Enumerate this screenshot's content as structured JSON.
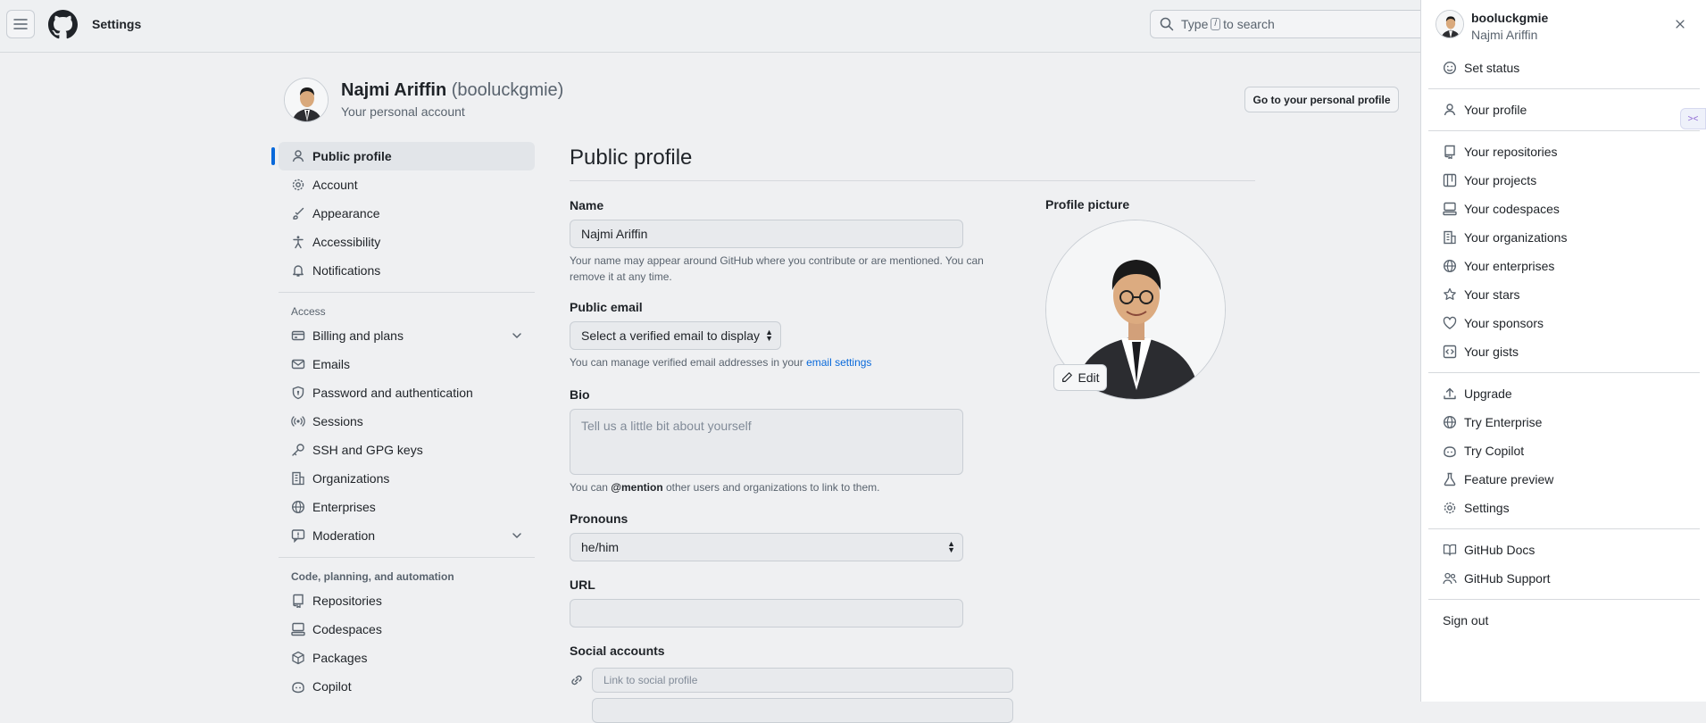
{
  "header": {
    "title": "Settings",
    "search": {
      "prefix": "Type",
      "key": "/",
      "suffix": "to search"
    }
  },
  "account": {
    "name": "Najmi Ariffin",
    "handle": "(booluckgmie)",
    "subtitle": "Your personal account",
    "goto_button": "Go to your personal profile"
  },
  "nav": {
    "items_top": [
      {
        "label": "Public profile",
        "icon": "person-icon",
        "active": true
      },
      {
        "label": "Account",
        "icon": "gear-icon"
      },
      {
        "label": "Appearance",
        "icon": "paintbrush-icon"
      },
      {
        "label": "Accessibility",
        "icon": "accessibility-icon"
      },
      {
        "label": "Notifications",
        "icon": "bell-icon"
      }
    ],
    "access_heading": "Access",
    "items_access": [
      {
        "label": "Billing and plans",
        "icon": "credit-card-icon",
        "expandable": true
      },
      {
        "label": "Emails",
        "icon": "mail-icon"
      },
      {
        "label": "Password and authentication",
        "icon": "shield-lock-icon"
      },
      {
        "label": "Sessions",
        "icon": "broadcast-icon"
      },
      {
        "label": "SSH and GPG keys",
        "icon": "key-icon"
      },
      {
        "label": "Organizations",
        "icon": "organization-icon"
      },
      {
        "label": "Enterprises",
        "icon": "globe-icon"
      },
      {
        "label": "Moderation",
        "icon": "report-icon",
        "expandable": true
      }
    ],
    "code_heading": "Code, planning, and automation",
    "items_code": [
      {
        "label": "Repositories",
        "icon": "repo-icon"
      },
      {
        "label": "Codespaces",
        "icon": "codespaces-icon"
      },
      {
        "label": "Packages",
        "icon": "package-icon"
      },
      {
        "label": "Copilot",
        "icon": "copilot-icon"
      }
    ]
  },
  "main": {
    "title": "Public profile",
    "name_label": "Name",
    "name_value": "Najmi Ariffin",
    "name_note": "Your name may appear around GitHub where you contribute or are mentioned. You can remove it at any time.",
    "email_label": "Public email",
    "email_value": "Select a verified email to display",
    "email_note_prefix": "You can manage verified email addresses in your",
    "email_note_link": "email settings",
    "bio_label": "Bio",
    "bio_placeholder": "Tell us a little bit about yourself",
    "bio_note_prefix": "You can",
    "bio_note_mention": "@mention",
    "bio_note_suffix": "other users and organizations to link to them.",
    "pronouns_label": "Pronouns",
    "pronouns_value": "he/him",
    "url_label": "URL",
    "url_value": "",
    "social_label": "Social accounts",
    "social_placeholder": "Link to social profile",
    "picture_label": "Profile picture",
    "edit_label": "Edit"
  },
  "panel": {
    "username": "booluckgmie",
    "fullname": "Najmi Ariffin",
    "groups": [
      [
        {
          "label": "Set status",
          "icon": "smiley-icon"
        }
      ],
      [
        {
          "label": "Your profile",
          "icon": "person-icon"
        }
      ],
      [
        {
          "label": "Your repositories",
          "icon": "repo-icon"
        },
        {
          "label": "Your projects",
          "icon": "table-icon"
        },
        {
          "label": "Your codespaces",
          "icon": "codespaces-icon"
        },
        {
          "label": "Your organizations",
          "icon": "organization-icon"
        },
        {
          "label": "Your enterprises",
          "icon": "globe-icon"
        },
        {
          "label": "Your stars",
          "icon": "star-icon"
        },
        {
          "label": "Your sponsors",
          "icon": "heart-icon"
        },
        {
          "label": "Your gists",
          "icon": "code-square-icon"
        }
      ],
      [
        {
          "label": "Upgrade",
          "icon": "upload-icon"
        },
        {
          "label": "Try Enterprise",
          "icon": "globe-icon"
        },
        {
          "label": "Try Copilot",
          "icon": "copilot-icon"
        },
        {
          "label": "Feature preview",
          "icon": "beaker-icon"
        },
        {
          "label": "Settings",
          "icon": "gear-icon"
        }
      ],
      [
        {
          "label": "GitHub Docs",
          "icon": "book-icon"
        },
        {
          "label": "GitHub Support",
          "icon": "people-icon"
        }
      ]
    ],
    "sign_out": "Sign out"
  }
}
